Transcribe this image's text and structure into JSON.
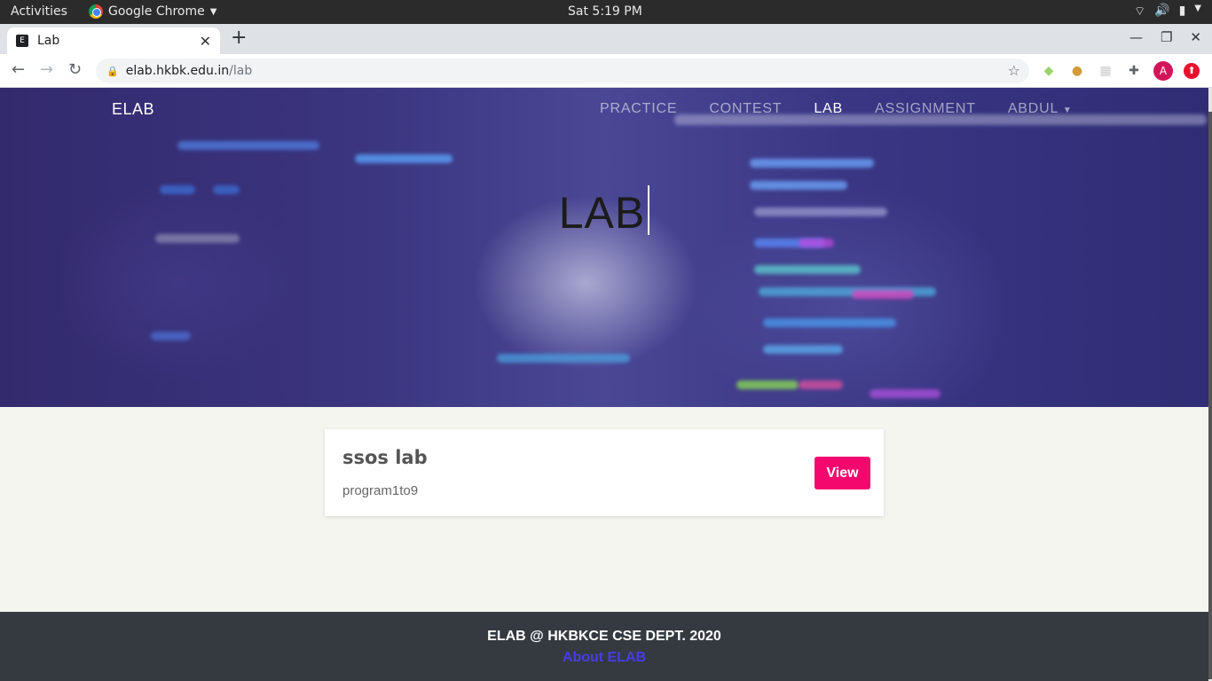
{
  "system_bar": {
    "activities": "Activities",
    "app_name": "Google Chrome",
    "clock": "Sat  5:19 PM"
  },
  "browser": {
    "tab_title": "Lab",
    "url_host": "elab.hkbk.edu.in",
    "url_path": "/lab",
    "profile_initial": "A"
  },
  "site": {
    "brand": "ELAB",
    "nav": [
      "PRACTICE",
      "CONTEST",
      "LAB",
      "ASSIGNMENT",
      "ABDUL"
    ],
    "active_nav": "LAB",
    "hero_title": "LAB"
  },
  "lab_card": {
    "title": "ssos lab",
    "subtitle": "program1to9",
    "button": "View"
  },
  "footer": {
    "copyright": "ELAB @ HKBKCE CSE DEPT. 2020",
    "about_link": "About ELAB"
  },
  "colors": {
    "accent_button": "#f5086e",
    "footer_bg": "#343a40",
    "about_link": "#4a3ae8",
    "hero_base": "#3b357f"
  }
}
